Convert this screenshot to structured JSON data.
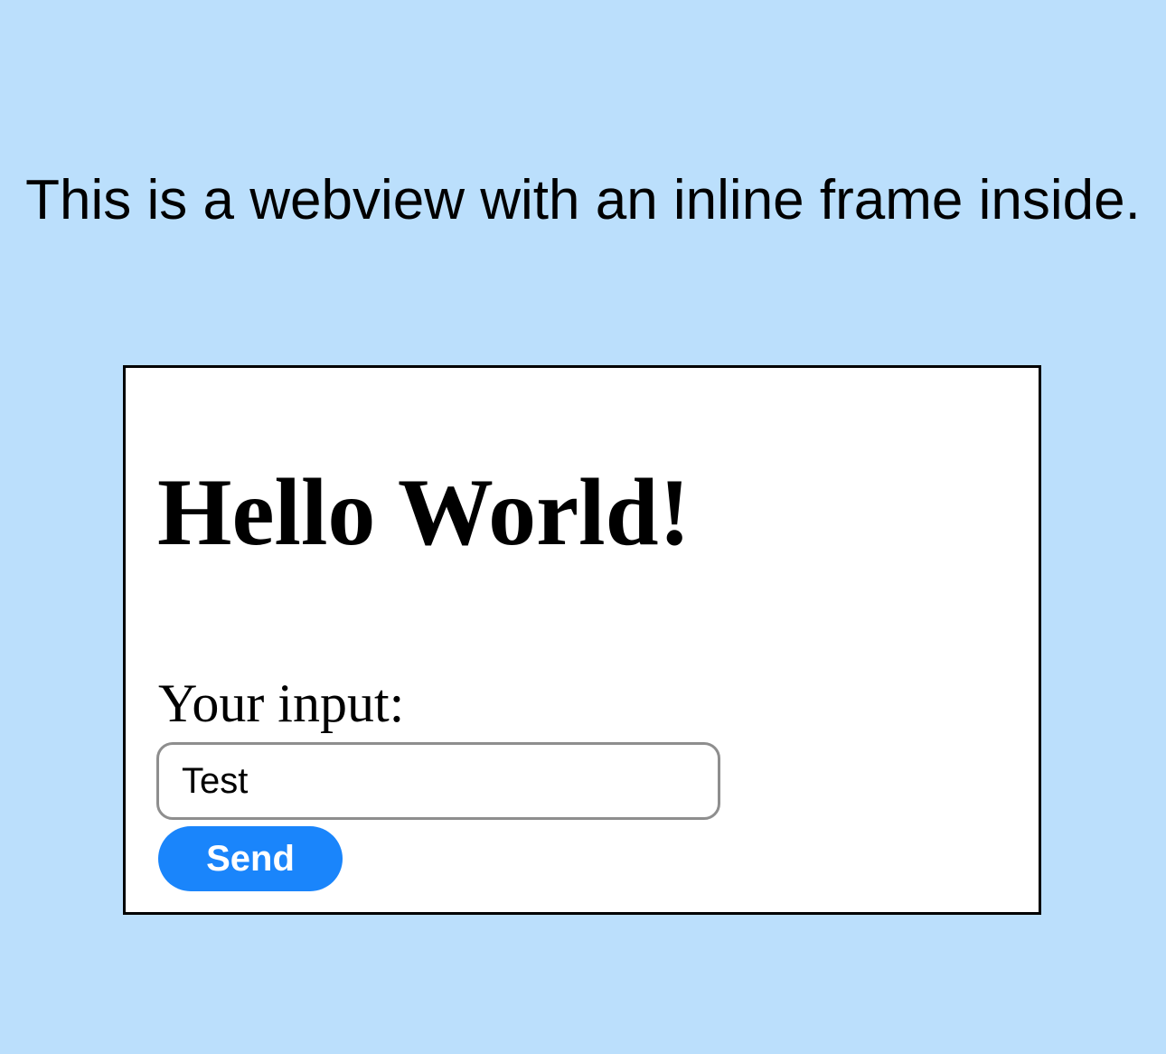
{
  "intro": {
    "text": "This is a webview with an inline frame inside."
  },
  "iframe": {
    "heading": "Hello World!",
    "input_label": "Your input:",
    "input_value": "Test",
    "send_label": "Send"
  },
  "colors": {
    "page_background": "#bbdffc",
    "frame_background": "#ffffff",
    "frame_border": "#000000",
    "button_background": "#1a85fb",
    "button_text": "#ffffff",
    "input_border": "#8e8e8e"
  }
}
